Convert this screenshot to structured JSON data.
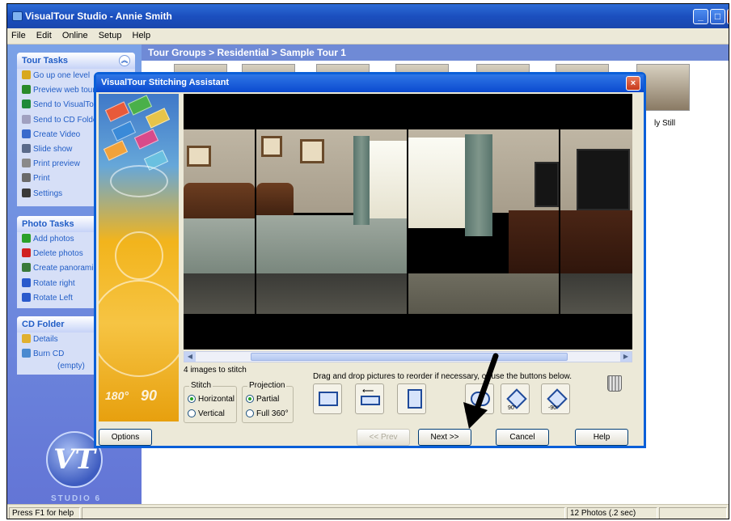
{
  "app": {
    "title": "VisualTour Studio - Annie Smith",
    "minimize_icon": "minimize-icon",
    "maximize_icon": "maximize-icon",
    "close_icon": "close-icon"
  },
  "menu": [
    "File",
    "Edit",
    "Online",
    "Setup",
    "Help"
  ],
  "tour_tasks": {
    "title": "Tour Tasks",
    "items": [
      {
        "label": "Go up one level",
        "icon": "folder-up-icon",
        "color": "#d8a81e"
      },
      {
        "label": "Preview web tour",
        "icon": "preview-icon",
        "color": "#2a8a2a"
      },
      {
        "label": "Send to VisualTour",
        "icon": "globe-icon",
        "color": "#1e8a3a"
      },
      {
        "label": "Send to CD Folder",
        "icon": "cd-icon",
        "color": "#a0a0c0"
      },
      {
        "label": "Create Video",
        "icon": "video-icon",
        "color": "#3a6acc"
      },
      {
        "label": "Slide show",
        "icon": "slideshow-icon",
        "color": "#5a6a8a"
      },
      {
        "label": "Print preview",
        "icon": "print-preview-icon",
        "color": "#8a8a8a"
      },
      {
        "label": "Print",
        "icon": "print-icon",
        "color": "#6a6a6a"
      },
      {
        "label": "Settings",
        "icon": "settings-icon",
        "color": "#3a3a3a"
      }
    ]
  },
  "photo_tasks": {
    "title": "Photo Tasks",
    "items": [
      {
        "label": "Add photos",
        "icon": "add-icon",
        "color": "#2aa02a"
      },
      {
        "label": "Delete photos",
        "icon": "delete-icon",
        "color": "#d02020"
      },
      {
        "label": "Create panoramic",
        "icon": "panoramic-icon",
        "color": "#3a7a3a"
      },
      {
        "label": "Rotate right",
        "icon": "rotate-right-icon",
        "color": "#2a5acc"
      },
      {
        "label": "Rotate Left",
        "icon": "rotate-left-icon",
        "color": "#2a5acc"
      }
    ]
  },
  "cd_folder": {
    "title": "CD Folder",
    "items": [
      {
        "label": "Details",
        "icon": "details-icon",
        "color": "#e0b030"
      },
      {
        "label": "Burn CD",
        "icon": "burn-cd-icon",
        "color": "#4a8ad0"
      }
    ],
    "empty_label": "(empty)"
  },
  "studio_label": "STUDIO 6",
  "breadcrumb": "Tour Groups > Residential > Sample Tour 1",
  "thumb_caption": "ly Still",
  "status": {
    "help": "Press F1 for help",
    "photos": "12 Photos (.2 sec)"
  },
  "dialog": {
    "title": "VisualTour Stitching Assistant",
    "count_label": "4 images to stitch",
    "instructions": "Drag and drop pictures to reorder if necessary, or use the buttons below.",
    "stitch": {
      "title": "Stitch",
      "options": [
        "Horizontal",
        "Vertical"
      ],
      "selected": "Horizontal"
    },
    "projection": {
      "title": "Projection",
      "options": [
        "Partial",
        "Full 360°"
      ],
      "selected": "Partial"
    },
    "tools": [
      {
        "name": "reorder-tool",
        "icon": "reorder-icon"
      },
      {
        "name": "move-left-tool",
        "icon": "move-left-icon"
      },
      {
        "name": "move-down-tool",
        "icon": "move-down-icon"
      },
      {
        "name": "flip-tool",
        "icon": "flip-icon"
      },
      {
        "name": "rotate-right-90-tool",
        "icon": "rotate-right-90-icon",
        "deg": "90°"
      },
      {
        "name": "rotate-left-90-tool",
        "icon": "rotate-left-90-icon",
        "deg": "-90°"
      }
    ],
    "art_numbers": [
      "180°",
      "90"
    ],
    "buttons": {
      "options": "Options",
      "prev": "<< Prev",
      "next": "Next >>",
      "cancel": "Cancel",
      "help": "Help"
    }
  }
}
